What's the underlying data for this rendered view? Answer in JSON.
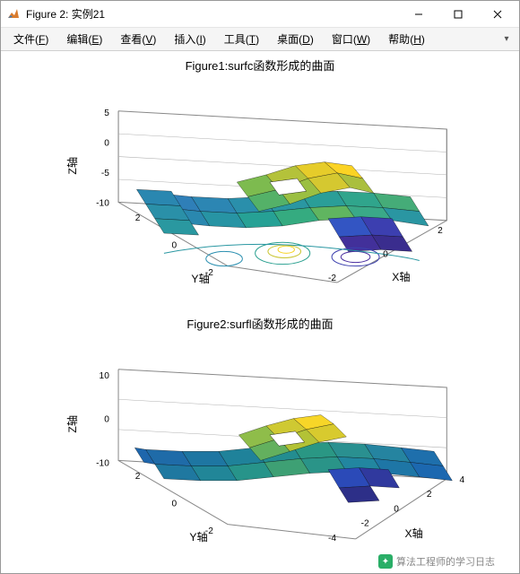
{
  "window": {
    "title": "Figure 2: 实例21"
  },
  "menu": {
    "items": [
      {
        "label": "文件",
        "accel": "F"
      },
      {
        "label": "编辑",
        "accel": "E"
      },
      {
        "label": "查看",
        "accel": "V"
      },
      {
        "label": "插入",
        "accel": "I"
      },
      {
        "label": "工具",
        "accel": "T"
      },
      {
        "label": "桌面",
        "accel": "D"
      },
      {
        "label": "窗口",
        "accel": "W"
      },
      {
        "label": "帮助",
        "accel": "H"
      }
    ]
  },
  "subplots": {
    "top": {
      "title": "Figure1:surfc函数形成的曲面",
      "xlabel": "X轴",
      "ylabel": "Y轴",
      "zlabel": "Z轴",
      "xticks": [
        "-2",
        "0",
        "2"
      ],
      "yticks": [
        "-2",
        "0",
        "2"
      ],
      "zticks": [
        "-10",
        "-5",
        "0",
        "5"
      ]
    },
    "bottom": {
      "title": "Figure2:surfl函数形成的曲面",
      "xlabel": "X轴",
      "ylabel": "Y轴",
      "zlabel": "Z轴",
      "xticks": [
        "-4",
        "-2",
        "0",
        "2",
        "4"
      ],
      "yticks": [
        "-2",
        "0",
        "2"
      ],
      "zticks": [
        "-10",
        "0",
        "10"
      ]
    }
  },
  "chart_data": [
    {
      "type": "surface",
      "function": "peaks",
      "render": "surfc",
      "description": "MATLAB peaks(x,y) surface with contour projection on base plane",
      "x_range": [
        -3,
        3
      ],
      "y_range": [
        -3,
        3
      ],
      "z_range_approx": [
        -10,
        8
      ],
      "xlim": [
        -3,
        3
      ],
      "ylim": [
        -3,
        3
      ],
      "zlim": [
        -10,
        8
      ],
      "xticks": [
        -2,
        0,
        2
      ],
      "yticks": [
        -2,
        0,
        2
      ],
      "zticks": [
        -10,
        -5,
        0,
        5
      ],
      "title": "Figure1:surfc函数形成的曲面",
      "xlabel": "X轴",
      "ylabel": "Y轴",
      "zlabel": "Z轴",
      "colormap": "parula",
      "has_contour_floor": true
    },
    {
      "type": "surface",
      "function": "peaks",
      "render": "surfl",
      "description": "MATLAB peaks(x,y) surface with lighting (surfl)",
      "x_range": [
        -4,
        4
      ],
      "y_range": [
        -3,
        3
      ],
      "z_range_approx": [
        -10,
        10
      ],
      "xlim": [
        -4,
        4
      ],
      "ylim": [
        -3,
        3
      ],
      "zlim": [
        -12,
        12
      ],
      "xticks": [
        -4,
        -2,
        0,
        2,
        4
      ],
      "yticks": [
        -2,
        0,
        2
      ],
      "zticks": [
        -10,
        0,
        10
      ],
      "title": "Figure2:surfl函数形成的曲面",
      "xlabel": "X轴",
      "ylabel": "Y轴",
      "zlabel": "Z轴",
      "colormap": "parula",
      "has_contour_floor": false
    }
  ],
  "watermark": {
    "text": "算法工程师的学习日志"
  }
}
